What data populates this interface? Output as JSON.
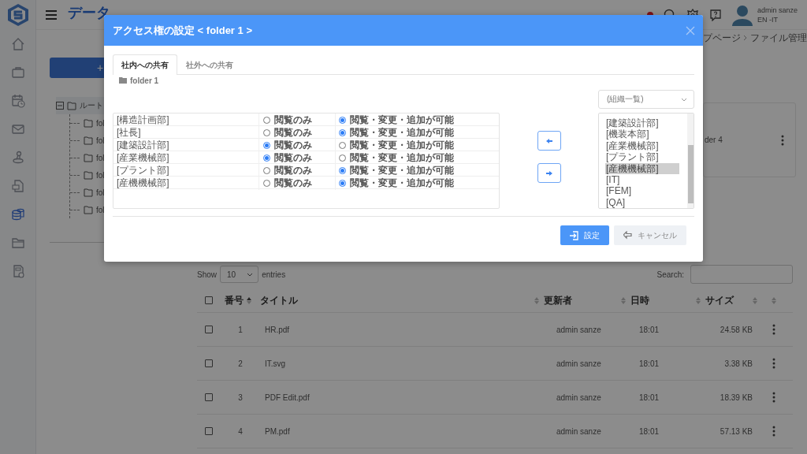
{
  "sidebar": {
    "items": [
      {
        "selected": false
      },
      {
        "selected": false
      },
      {
        "selected": false
      },
      {
        "selected": false
      },
      {
        "selected": false
      },
      {
        "selected": false
      },
      {
        "selected": true
      },
      {
        "selected": false
      },
      {
        "selected": false
      }
    ]
  },
  "header": {
    "title": "データ",
    "user_name": "admin sanze",
    "user_org": "EN -IT"
  },
  "breadcrumb": [
    "プページ",
    "ファイル管理"
  ],
  "new_button": "+",
  "tree": {
    "label": "ルート",
    "expanded": true,
    "children": [
      {
        "label": "fol"
      },
      {
        "label": "fol"
      },
      {
        "label": "fol"
      },
      {
        "label": "fol"
      },
      {
        "label": "fol"
      },
      {
        "label": "fol"
      }
    ]
  },
  "folder_card": {
    "label": "der 4"
  },
  "file_table": {
    "show_label": "Show",
    "page_length": "10",
    "entries_label": "entries",
    "search_label": "Search:",
    "select_all": {
      "checked": false
    },
    "columns": [
      {
        "label": "番号",
        "sorted": true
      },
      {
        "label": "タイトル",
        "sorted": false
      },
      {
        "label": "更新者",
        "sorted": false
      },
      {
        "label": "日時",
        "sorted": false
      },
      {
        "label": "サイズ",
        "sorted": false
      }
    ],
    "rows": [
      {
        "checked": false,
        "no": "1",
        "title": "HR.pdf",
        "updater": "admin sanze",
        "time": "18:01",
        "size": "24.58 KB"
      },
      {
        "checked": false,
        "no": "2",
        "title": "IT.svg",
        "updater": "admin sanze",
        "time": "18:01",
        "size": "3.38 KB"
      },
      {
        "checked": false,
        "no": "3",
        "title": "PDF Edit.pdf",
        "updater": "admin sanze",
        "time": "18:01",
        "size": "18.39 KB"
      },
      {
        "checked": false,
        "no": "4",
        "title": "PM.pdf",
        "updater": "admin sanze",
        "time": "18:01",
        "size": "57.13 KB"
      }
    ]
  },
  "dialog": {
    "title": "アクセス権の設定 < folder 1 >",
    "tabs": [
      {
        "label": "社内への共有",
        "selected": true
      },
      {
        "label": "社外への共有",
        "selected": false
      }
    ],
    "folder": "folder 1",
    "org_select": "(組織一覧)",
    "permissions": [
      {
        "name": "[構造計画部]",
        "options": [
          {
            "label": "閲覧のみ",
            "selected": false
          },
          {
            "label": "閲覧・変更・追加が可能",
            "selected": true
          }
        ]
      },
      {
        "name": "[社長]",
        "options": [
          {
            "label": "閲覧のみ",
            "selected": false
          },
          {
            "label": "閲覧・変更・追加が可能",
            "selected": true
          }
        ]
      },
      {
        "name": "[建築設計部]",
        "options": [
          {
            "label": "閲覧のみ",
            "selected": true
          },
          {
            "label": "閲覧・変更・追加が可能",
            "selected": false
          }
        ]
      },
      {
        "name": "[産業機械部]",
        "options": [
          {
            "label": "閲覧のみ",
            "selected": true
          },
          {
            "label": "閲覧・変更・追加が可能",
            "selected": false
          }
        ]
      },
      {
        "name": "[プラント部]",
        "options": [
          {
            "label": "閲覧のみ",
            "selected": false
          },
          {
            "label": "閲覧・変更・追加が可能",
            "selected": true
          }
        ]
      },
      {
        "name": "[産機機械部]",
        "options": [
          {
            "label": "閲覧のみ",
            "selected": false
          },
          {
            "label": "閲覧・変更・追加が可能",
            "selected": true
          }
        ]
      }
    ],
    "org_list": [
      {
        "label": "[建築設計部]",
        "selected": false
      },
      {
        "label": "[機装本部]",
        "selected": false
      },
      {
        "label": "[産業機械部]",
        "selected": false
      },
      {
        "label": "[プラント部]",
        "selected": false
      },
      {
        "label": "[産機機械部]",
        "selected": true
      },
      {
        "label": "[IT]",
        "selected": false
      },
      {
        "label": "[FEM]",
        "selected": false
      },
      {
        "label": "[QA]",
        "selected": false
      }
    ],
    "buttons": [
      {
        "kind": "primary",
        "label": "設定"
      },
      {
        "kind": "secondary",
        "label": "キャンセル"
      }
    ]
  }
}
